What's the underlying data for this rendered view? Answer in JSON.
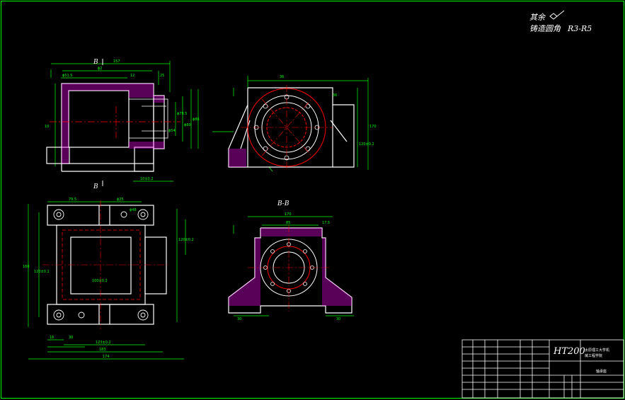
{
  "notes": {
    "line1": "其余",
    "line2": "铸造圆角",
    "line2_value": "R3-R5"
  },
  "sections": {
    "top_label": "B",
    "bottom_label": "B",
    "section_view": "B-B"
  },
  "title_block": {
    "material": "HT200",
    "school": "太原理工大学机",
    "dept": "械工程学院",
    "part_name": "轴承座"
  },
  "dimensions": {
    "front_top": [
      "157",
      "ϕ2",
      "ϕ51.5",
      "25",
      "12"
    ],
    "front_right": [
      "ϕ86",
      "ϕ80",
      "ϕ79.5",
      "ϕ54",
      "10"
    ],
    "front_bottom": "10±0.2",
    "side_top": [
      "36",
      "36"
    ],
    "side_right": [
      "170",
      "120±0.2"
    ],
    "plan_top": [
      "79.5",
      "ϕ25",
      "ϕ48"
    ],
    "plan_left": "160",
    "plan_right": [
      "120±0.1",
      "120±0.2"
    ],
    "plan_bottom": [
      "16",
      "30",
      "123±0.2",
      "183",
      "174"
    ],
    "plan_inner": "100±0.2",
    "section_top": [
      "170",
      "85",
      "17.5"
    ],
    "section_bottom": [
      "30",
      "30"
    ]
  }
}
